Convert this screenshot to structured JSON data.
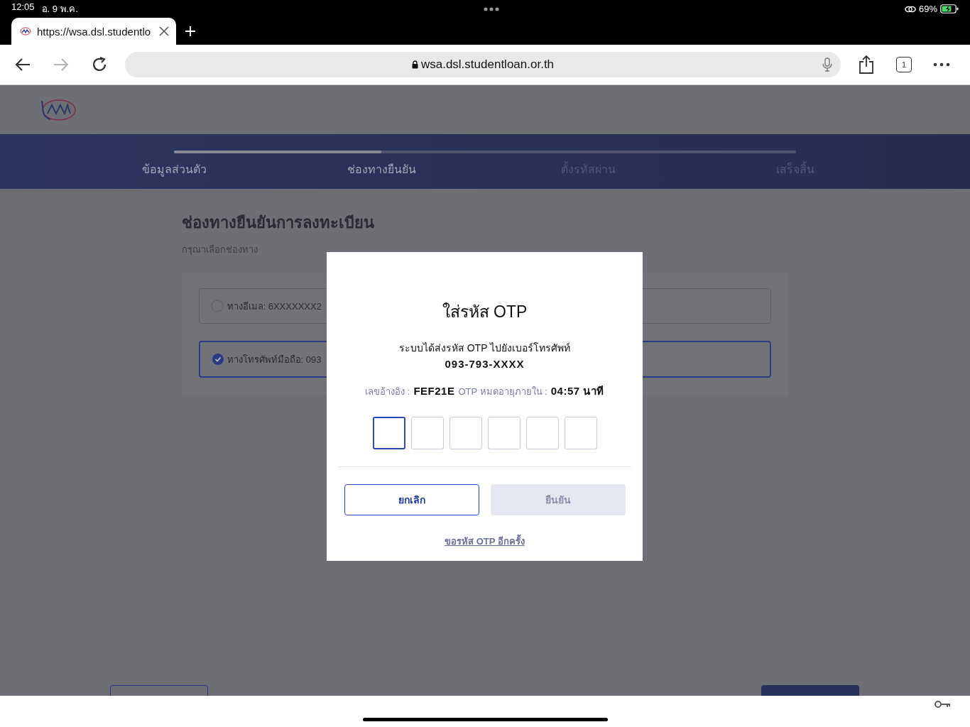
{
  "status_bar": {
    "time": "12:05",
    "date": "อ. 9 พ.ค.",
    "battery": "69%"
  },
  "browser": {
    "tab_title": "https://wsa.dsl.studentlo",
    "address": "wsa.dsl.studentloan.or.th",
    "tab_count": "1",
    "forward_disabled": true
  },
  "stepper": {
    "level": 0.333,
    "steps": [
      {
        "label": "ข้อมูลส่วนตัว",
        "reached": true
      },
      {
        "label": "ช่องทางยืนยัน",
        "reached": true
      },
      {
        "label": "ตั้งรหัสผ่าน",
        "reached": false
      },
      {
        "label": "เสร็จสิ้น",
        "reached": false
      }
    ]
  },
  "page": {
    "title": "ช่องทางยืนยันการลงทะเบียน",
    "subtitle": "กรุณาเลือกช่องทาง",
    "options": [
      {
        "label": "ทางอีเมล: 6XXXXXXX2",
        "selected": false
      },
      {
        "label": "ทางโทรศัพท์มือถือ: 093",
        "selected": true
      }
    ]
  },
  "dialog": {
    "title": "ใส่รหัส OTP",
    "message": "ระบบได้ส่งรหัส OTP ไปยังเบอร์โทรศัพท์",
    "phone": "093-793-XXXX",
    "ref_label": "เลขอ้างอิง :",
    "ref_code": "FEF21E",
    "expiry_label": "OTP หมดอายุภายใน :",
    "expiry_time": "04:57 นาที",
    "otp_boxes": [
      {
        "focused": true
      },
      {
        "focused": false
      },
      {
        "focused": false
      },
      {
        "focused": false
      },
      {
        "focused": false
      },
      {
        "focused": false
      }
    ],
    "cancel": "ยกเลิก",
    "confirm": "ยืนยัน",
    "confirm_disabled": true,
    "resend": "ขอรหัส OTP อีกครั้ง"
  }
}
